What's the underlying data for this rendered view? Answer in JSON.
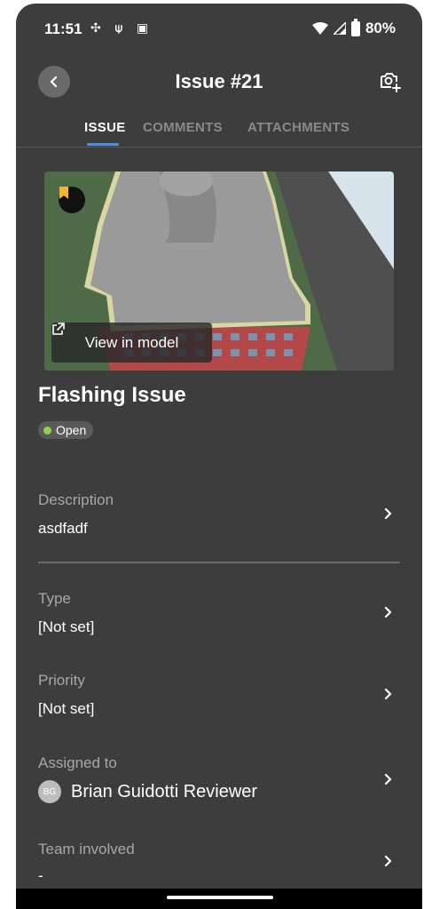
{
  "status_bar": {
    "time": "11:51",
    "notification_icons": "✣ ⍦ ▣",
    "battery": "80%"
  },
  "header": {
    "title": "Issue #21",
    "back_icon": "chevron-left-icon",
    "action_icon": "add-photo-icon"
  },
  "tabs": [
    {
      "label": "ISSUE",
      "active": true
    },
    {
      "label": "COMMENTS",
      "active": false
    },
    {
      "label": "ATTACHMENTS",
      "active": false
    }
  ],
  "thumbnail": {
    "view_in_model_label": "View in model",
    "badge_icon": "bookmark-icon"
  },
  "issue": {
    "title": "Flashing Issue",
    "status": "Open",
    "status_color": "#8fd14f"
  },
  "fields": {
    "description": {
      "label": "Description",
      "value": "asdfadf"
    },
    "type": {
      "label": "Type",
      "value": "[Not set]"
    },
    "priority": {
      "label": "Priority",
      "value": "[Not set]"
    },
    "assigned_to": {
      "label": "Assigned to",
      "initials": "BG",
      "value": "Brian Guidotti Reviewer"
    },
    "team_involved": {
      "label": "Team involved",
      "value": "-"
    }
  },
  "colors": {
    "background": "#3d3d3d",
    "accent": "#4a90e2"
  }
}
